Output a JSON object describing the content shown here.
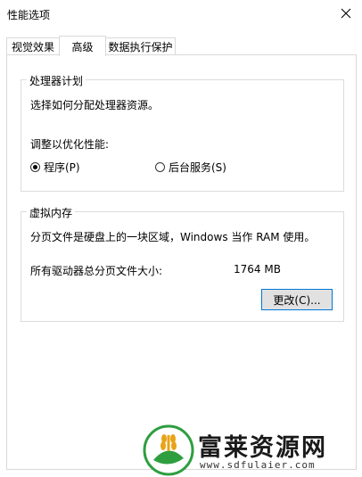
{
  "window": {
    "title": "性能选项"
  },
  "tabs": [
    {
      "label": "视觉效果"
    },
    {
      "label": "高级"
    },
    {
      "label": "数据执行保护"
    }
  ],
  "processor": {
    "legend": "处理器计划",
    "description": "选择如何分配处理器资源。",
    "optimize_label": "调整以优化性能:",
    "options": [
      {
        "label": "程序(P)",
        "selected": true
      },
      {
        "label": "后台服务(S)",
        "selected": false
      }
    ]
  },
  "virtual_memory": {
    "legend": "虚拟内存",
    "description": "分页文件是硬盘上的一块区域，Windows 当作 RAM 使用。",
    "total_label": "所有驱动器总分页文件大小:",
    "total_value": "1764 MB",
    "change_button": "更改(C)..."
  },
  "watermark": {
    "name": "富莱资源网",
    "url": "www.sdfulaier.com"
  }
}
